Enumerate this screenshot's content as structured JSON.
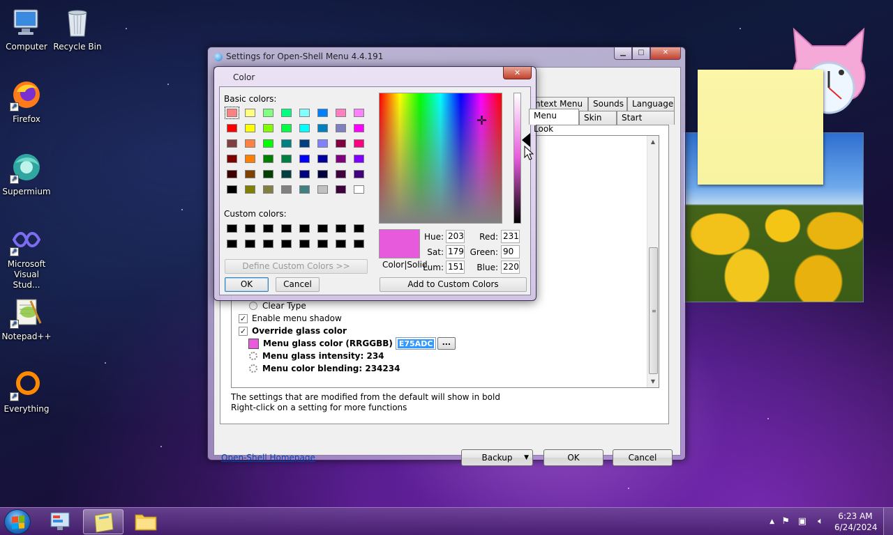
{
  "desktop": {
    "icons": [
      {
        "label": "Computer"
      },
      {
        "label": "Recycle Bin"
      },
      {
        "label": "Firefox"
      },
      {
        "label": "Supermium"
      },
      {
        "label": "Microsoft Visual Stud..."
      },
      {
        "label": "Notepad++"
      },
      {
        "label": "Everything"
      }
    ]
  },
  "settings_window": {
    "title": "Settings for Open-Shell Menu 4.4.191",
    "tabs": {
      "context_menu": "ntext Menu",
      "sounds": "Sounds",
      "language": "Language",
      "menu_look": "Menu Look",
      "skin": "Skin",
      "start_button": "Start Button"
    },
    "settings": {
      "clear_type": "Clear Type",
      "enable_menu_shadow": "Enable menu shadow",
      "override_glass_color": "Override glass color",
      "menu_glass_color": "Menu glass color (RRGGBB)",
      "menu_glass_color_value": "E75ADC",
      "menu_glass_intensity": "Menu glass intensity: 234",
      "menu_color_blending": "Menu color blending: 234234",
      "browse_label": "...",
      "swatch_color": "#e75adc"
    },
    "hints": {
      "line1": "The settings that are modified from the default will show in bold",
      "line2": "Right-click on a setting for more functions"
    },
    "homepage_link": "Open-Shell Homepage",
    "buttons": {
      "backup": "Backup",
      "ok": "OK",
      "cancel": "Cancel"
    }
  },
  "color_dialog": {
    "title": "Color",
    "close_label": "✕",
    "basic_colors_label": "Basic colors:",
    "custom_colors_label": "Custom colors:",
    "basic_colors": [
      "#ff8080",
      "#ffff80",
      "#80ff80",
      "#00ff80",
      "#80ffff",
      "#0080ff",
      "#ff80c0",
      "#ff80ff",
      "#ff0000",
      "#ffff00",
      "#80ff00",
      "#00ff40",
      "#00ffff",
      "#0080c0",
      "#8080c0",
      "#ff00ff",
      "#804040",
      "#ff8040",
      "#00ff00",
      "#008080",
      "#004080",
      "#8080ff",
      "#800040",
      "#ff0080",
      "#800000",
      "#ff8000",
      "#008000",
      "#008040",
      "#0000ff",
      "#0000a0",
      "#800080",
      "#8000ff",
      "#400000",
      "#804000",
      "#004000",
      "#004040",
      "#000080",
      "#000040",
      "#400040",
      "#400080",
      "#000000",
      "#808000",
      "#808040",
      "#808080",
      "#408080",
      "#c0c0c0",
      "#400040",
      "#ffffff"
    ],
    "custom_colors": [
      "#000000",
      "#000000",
      "#000000",
      "#000000",
      "#000000",
      "#000000",
      "#000000",
      "#000000",
      "#000000",
      "#000000",
      "#000000",
      "#000000",
      "#000000",
      "#000000",
      "#000000",
      "#000000"
    ],
    "define_custom_label": "Define Custom Colors >>",
    "ok_label": "OK",
    "cancel_label": "Cancel",
    "add_custom_label": "Add to Custom Colors",
    "color_solid_label": "Color|Solid",
    "selected_color": "#e75adc",
    "fields": {
      "hue_label": "Hue:",
      "hue": "203",
      "sat_label": "Sat:",
      "sat": "179",
      "lum_label": "Lum:",
      "lum": "151",
      "red_label": "Red:",
      "red": "231",
      "green_label": "Green:",
      "green": "90",
      "blue_label": "Blue:",
      "blue": "220"
    }
  },
  "taskbar": {
    "time": "6:23 AM",
    "date": "6/24/2024"
  }
}
